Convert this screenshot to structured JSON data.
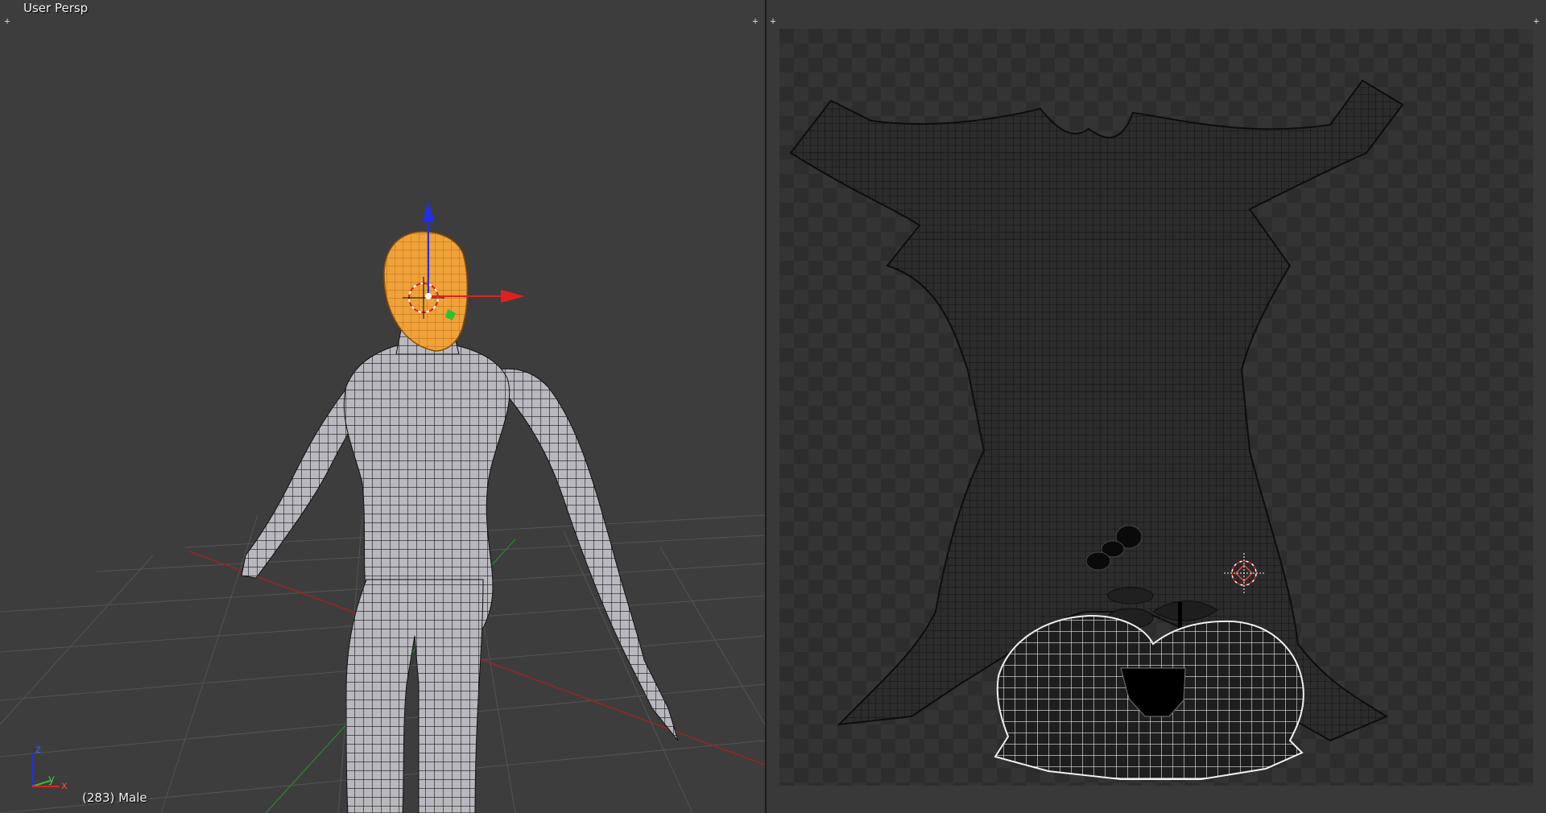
{
  "viewport": {
    "view_label": "User Persp",
    "object_info": "(283) Male",
    "axis_labels": {
      "z": "z",
      "y": "y",
      "x": "x"
    }
  },
  "uv_editor": {},
  "colors": {
    "selection": "#f5a623",
    "x_axis": "#e02020",
    "y_axis": "#30c030",
    "z_axis": "#2030e0",
    "mesh_fill": "#b9b9bf",
    "wire": "#111111"
  },
  "icons": [
    "corner-plus-icon",
    "manipulator-widget",
    "3d-cursor-icon",
    "axis-gizmo-icon",
    "uv-cursor-icon"
  ]
}
